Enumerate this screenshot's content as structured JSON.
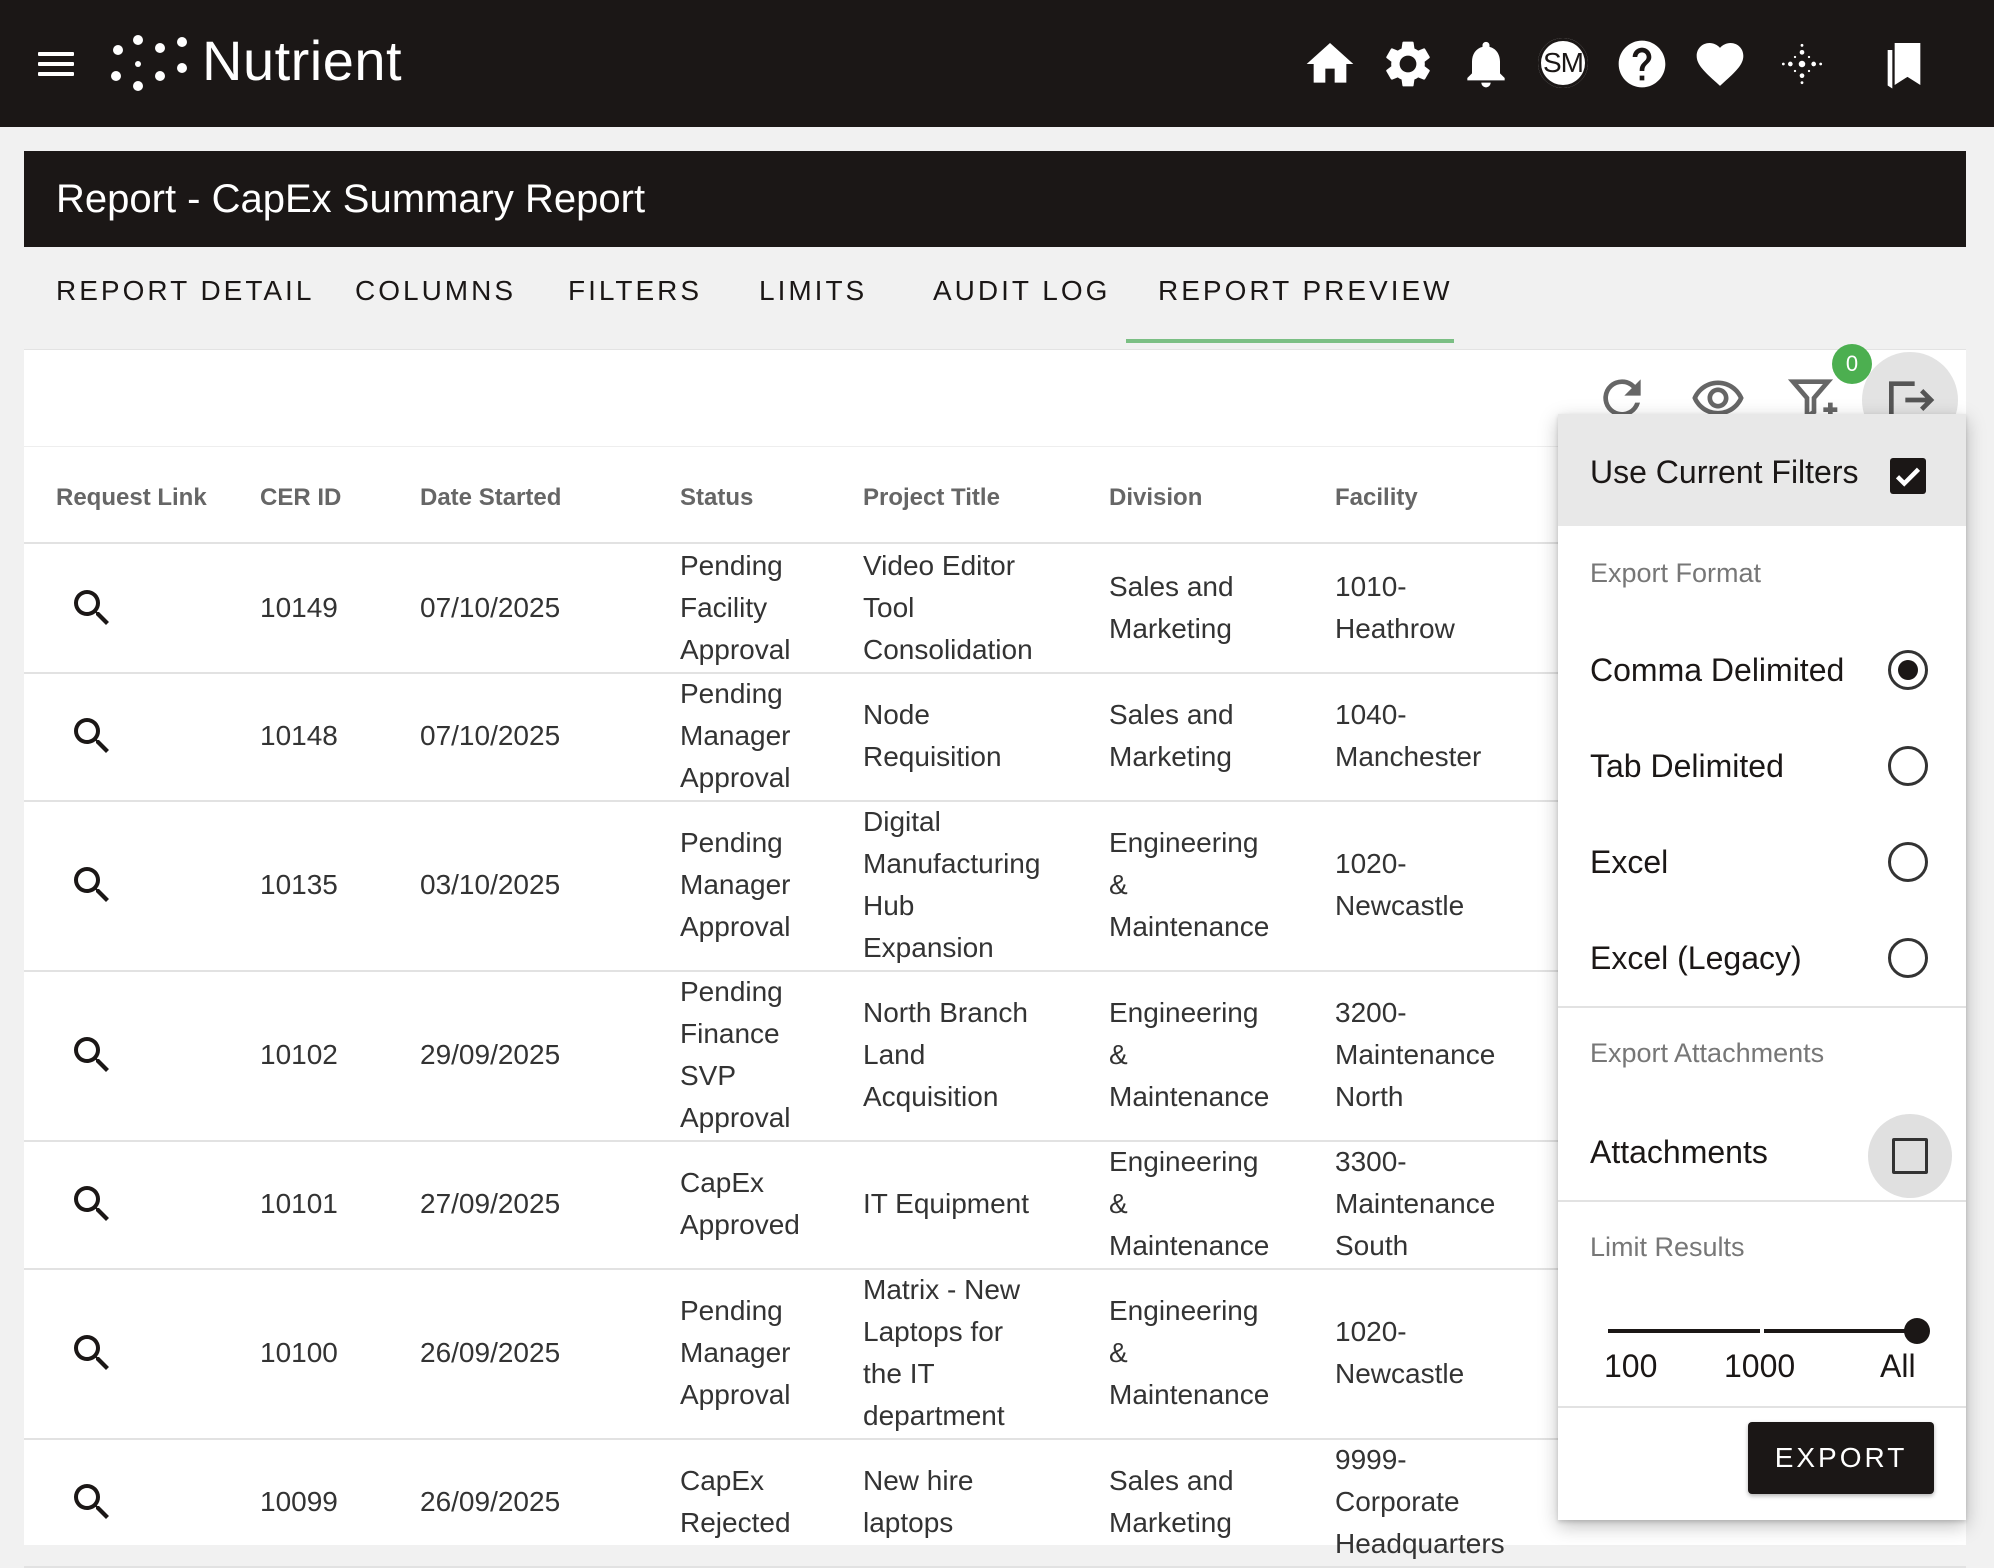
{
  "app": {
    "name": "Nutrient",
    "user_initials": "SM"
  },
  "report": {
    "title": "Report - CapEx Summary Report"
  },
  "tabs": [
    {
      "label": "REPORT DETAIL"
    },
    {
      "label": "COLUMNS"
    },
    {
      "label": "FILTERS"
    },
    {
      "label": "LIMITS"
    },
    {
      "label": "AUDIT LOG"
    },
    {
      "label": "REPORT PREVIEW",
      "active": true
    }
  ],
  "toolbar": {
    "filter_count": "0"
  },
  "table": {
    "headers": [
      "Request Link",
      "CER ID",
      "Date Started",
      "Status",
      "Project Title",
      "Division",
      "Facility"
    ],
    "rows": [
      {
        "cer_id": "10149",
        "date": "07/10/2025",
        "status": [
          "Pending",
          "Facility",
          "Approval"
        ],
        "title": [
          "Video Editor",
          "Tool",
          "Consolidation"
        ],
        "division": [
          "Sales and",
          "Marketing"
        ],
        "facility": [
          "1010-",
          "Heathrow"
        ]
      },
      {
        "cer_id": "10148",
        "date": "07/10/2025",
        "status": [
          "Pending",
          "Manager",
          "Approval"
        ],
        "title": [
          "Node",
          "Requisition"
        ],
        "division": [
          "Sales and",
          "Marketing"
        ],
        "facility": [
          "1040-",
          "Manchester"
        ]
      },
      {
        "cer_id": "10135",
        "date": "03/10/2025",
        "status": [
          "Pending",
          "Manager",
          "Approval"
        ],
        "title": [
          "Digital",
          "Manufacturing",
          "Hub",
          "Expansion"
        ],
        "division": [
          "Engineering",
          "&",
          "Maintenance"
        ],
        "facility": [
          "1020-",
          "Newcastle"
        ]
      },
      {
        "cer_id": "10102",
        "date": "29/09/2025",
        "status": [
          "Pending",
          "Finance",
          "SVP",
          "Approval"
        ],
        "title": [
          "North Branch",
          "Land",
          "Acquisition"
        ],
        "division": [
          "Engineering",
          "&",
          "Maintenance"
        ],
        "facility": [
          "3200-",
          "Maintenance",
          "North"
        ]
      },
      {
        "cer_id": "10101",
        "date": "27/09/2025",
        "status": [
          "CapEx",
          "Approved"
        ],
        "title": [
          "IT Equipment"
        ],
        "division": [
          "Engineering",
          "&",
          "Maintenance"
        ],
        "facility": [
          "3300-",
          "Maintenance",
          "South"
        ]
      },
      {
        "cer_id": "10100",
        "date": "26/09/2025",
        "status": [
          "Pending",
          "Manager",
          "Approval"
        ],
        "title": [
          "Matrix - New",
          "Laptops for",
          "the IT",
          "department"
        ],
        "division": [
          "Engineering",
          "&",
          "Maintenance"
        ],
        "facility": [
          "1020-",
          "Newcastle"
        ]
      },
      {
        "cer_id": "10099",
        "date": "26/09/2025",
        "status": [
          "CapEx",
          "Rejected"
        ],
        "title": [
          "New hire",
          "laptops"
        ],
        "division": [
          "Sales and",
          "Marketing"
        ],
        "facility": [
          "9999-",
          "Corporate",
          "Headquarters"
        ]
      }
    ]
  },
  "export_menu": {
    "use_current_filters": {
      "label": "Use Current Filters",
      "checked": true
    },
    "format_section": "Export Format",
    "formats": [
      {
        "label": "Comma Delimited",
        "selected": true
      },
      {
        "label": "Tab Delimited",
        "selected": false
      },
      {
        "label": "Excel",
        "selected": false
      },
      {
        "label": "Excel (Legacy)",
        "selected": false
      }
    ],
    "attachments_section": "Export Attachments",
    "attachments": {
      "label": "Attachments",
      "checked": false
    },
    "limit_section": "Limit Results",
    "limit_options": [
      "100",
      "1000",
      "All"
    ],
    "limit_selected": "All",
    "export_label": "EXPORT"
  },
  "colors": {
    "header_bg": "#1b1716",
    "accent_green": "#7bbf84",
    "badge_green": "#4caf50"
  }
}
